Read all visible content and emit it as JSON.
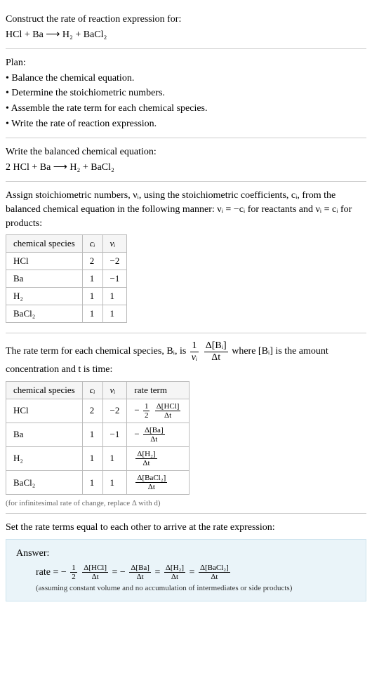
{
  "header": {
    "title": "Construct the rate of reaction expression for:",
    "equation": "HCl + Ba ⟶ H₂ + BaCl₂"
  },
  "plan": {
    "title": "Plan:",
    "items": [
      "• Balance the chemical equation.",
      "• Determine the stoichiometric numbers.",
      "• Assemble the rate term for each chemical species.",
      "• Write the rate of reaction expression."
    ]
  },
  "balanced": {
    "title": "Write the balanced chemical equation:",
    "equation": "2 HCl + Ba ⟶ H₂ + BaCl₂"
  },
  "stoich": {
    "intro_a": "Assign stoichiometric numbers, νᵢ, using the stoichiometric coefficients, cᵢ, from the balanced chemical equation in the following manner: νᵢ = −cᵢ for reactants and νᵢ = cᵢ for products:",
    "headers": [
      "chemical species",
      "cᵢ",
      "νᵢ"
    ],
    "rows": [
      {
        "species": "HCl",
        "c": "2",
        "nu": "−2"
      },
      {
        "species": "Ba",
        "c": "1",
        "nu": "−1"
      },
      {
        "species": "H₂",
        "c": "1",
        "nu": "1"
      },
      {
        "species": "BaCl₂",
        "c": "1",
        "nu": "1"
      }
    ]
  },
  "rateterm": {
    "intro_prefix": "The rate term for each chemical species, Bᵢ, is ",
    "frac1_num": "1",
    "frac1_den": "νᵢ",
    "frac2_num": "Δ[Bᵢ]",
    "frac2_den": "Δt",
    "intro_suffix": " where [Bᵢ] is the amount concentration and t is time:",
    "headers": [
      "chemical species",
      "cᵢ",
      "νᵢ",
      "rate term"
    ],
    "rows": [
      {
        "species": "HCl",
        "c": "2",
        "nu": "−2",
        "rt_prefix": "− ",
        "rt_f1n": "1",
        "rt_f1d": "2",
        "rt_f2n": "Δ[HCl]",
        "rt_f2d": "Δt"
      },
      {
        "species": "Ba",
        "c": "1",
        "nu": "−1",
        "rt_prefix": "− ",
        "rt_f1n": "",
        "rt_f1d": "",
        "rt_f2n": "Δ[Ba]",
        "rt_f2d": "Δt"
      },
      {
        "species": "H₂",
        "c": "1",
        "nu": "1",
        "rt_prefix": "",
        "rt_f1n": "",
        "rt_f1d": "",
        "rt_f2n": "Δ[H₂]",
        "rt_f2d": "Δt"
      },
      {
        "species": "BaCl₂",
        "c": "1",
        "nu": "1",
        "rt_prefix": "",
        "rt_f1n": "",
        "rt_f1d": "",
        "rt_f2n": "Δ[BaCl₂]",
        "rt_f2d": "Δt"
      }
    ],
    "note": "(for infinitesimal rate of change, replace Δ with d)"
  },
  "final": {
    "intro": "Set the rate terms equal to each other to arrive at the rate expression:",
    "answer_label": "Answer:",
    "eq": {
      "lhs": "rate = − ",
      "f1n": "1",
      "f1d": "2",
      "f2n": "Δ[HCl]",
      "f2d": "Δt",
      "eq1": " = − ",
      "f3n": "Δ[Ba]",
      "f3d": "Δt",
      "eq2": " = ",
      "f4n": "Δ[H₂]",
      "f4d": "Δt",
      "eq3": " = ",
      "f5n": "Δ[BaCl₂]",
      "f5d": "Δt"
    },
    "note": "(assuming constant volume and no accumulation of intermediates or side products)"
  }
}
